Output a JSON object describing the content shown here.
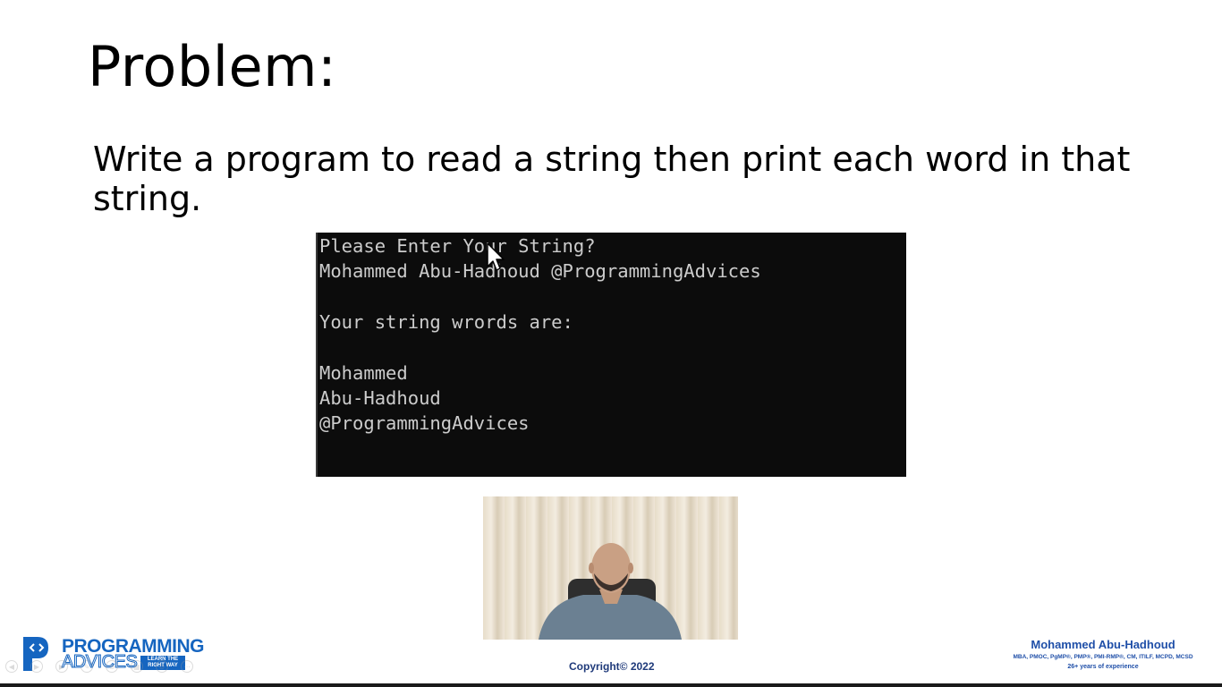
{
  "slide": {
    "title": "Problem:",
    "body": "Write a program to read a string then print each word in that string."
  },
  "console": {
    "lines": [
      "Please Enter Your String?",
      "Mohammed Abu-Hadhoud @ProgrammingAdvices",
      "",
      "Your string wrords are:",
      "",
      "Mohammed",
      "Abu-Hadhoud",
      "@ProgrammingAdvices"
    ]
  },
  "logo": {
    "line1": "PROGRAMMING",
    "line2": "ADVICES",
    "tagline": "LEARN THE RIGHT WAY"
  },
  "footer": {
    "copyright": "Copyright© 2022"
  },
  "author": {
    "name": "Mohammed Abu-Hadhoud",
    "credentials": "MBA, PMOC, PgMP®, PMP®, PMI-RMP®, CM, ITILF, MCPD, MCSD",
    "experience": "26+ years of experience"
  },
  "colors": {
    "brand_blue": "#1565c0",
    "console_bg": "#0c0c0c",
    "console_text": "#cccccc"
  }
}
